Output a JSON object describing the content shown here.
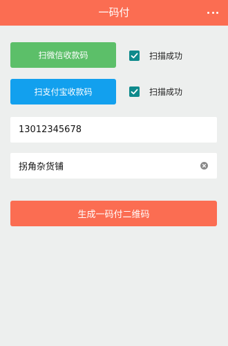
{
  "header": {
    "title": "一码付",
    "more_icon": "more-dots-icon"
  },
  "scan": {
    "wechat_label": "扫微信收款码",
    "alipay_label": "扫支付宝收款码",
    "wechat_status": "扫描成功",
    "alipay_status": "扫描成功",
    "wechat_checked": true,
    "alipay_checked": true
  },
  "form": {
    "phone_value": "13012345678",
    "shop_value": "拐角杂货铺"
  },
  "actions": {
    "generate_label": "生成一码付二维码"
  },
  "colors": {
    "primary": "#fb6d52",
    "wechat_green": "#5cbf69",
    "alipay_blue": "#12a0ee",
    "checkbox_teal": "#0e8a8c",
    "background": "#edefee"
  }
}
